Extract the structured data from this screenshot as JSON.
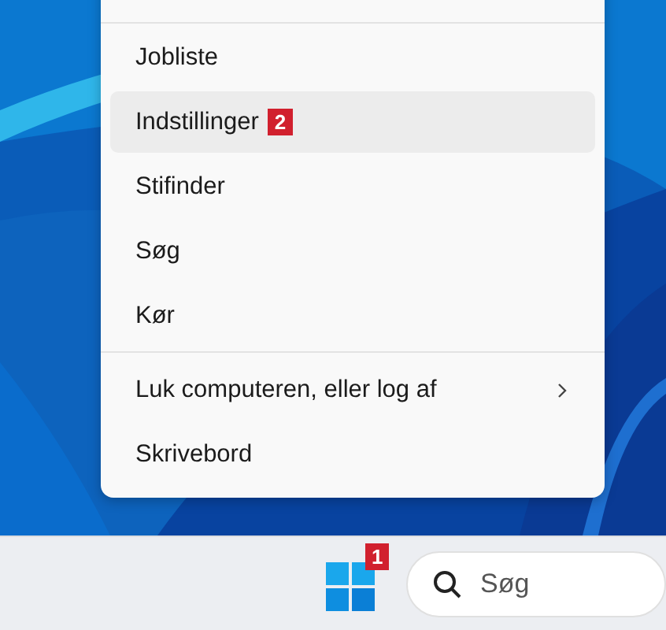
{
  "menu": {
    "groups": [
      {
        "items": [
          {
            "label": "Jobliste",
            "selected": false,
            "has_submenu": false
          },
          {
            "label": "Indstillinger",
            "selected": true,
            "has_submenu": false,
            "badge": "2"
          },
          {
            "label": "Stifinder",
            "selected": false,
            "has_submenu": false
          },
          {
            "label": "Søg",
            "selected": false,
            "has_submenu": false
          },
          {
            "label": "Kør",
            "selected": false,
            "has_submenu": false
          }
        ]
      },
      {
        "items": [
          {
            "label": "Luk computeren, eller log af",
            "selected": false,
            "has_submenu": true
          },
          {
            "label": "Skrivebord",
            "selected": false,
            "has_submenu": false
          }
        ]
      }
    ]
  },
  "taskbar": {
    "start_badge": "1",
    "search": {
      "placeholder": "Søg"
    }
  }
}
